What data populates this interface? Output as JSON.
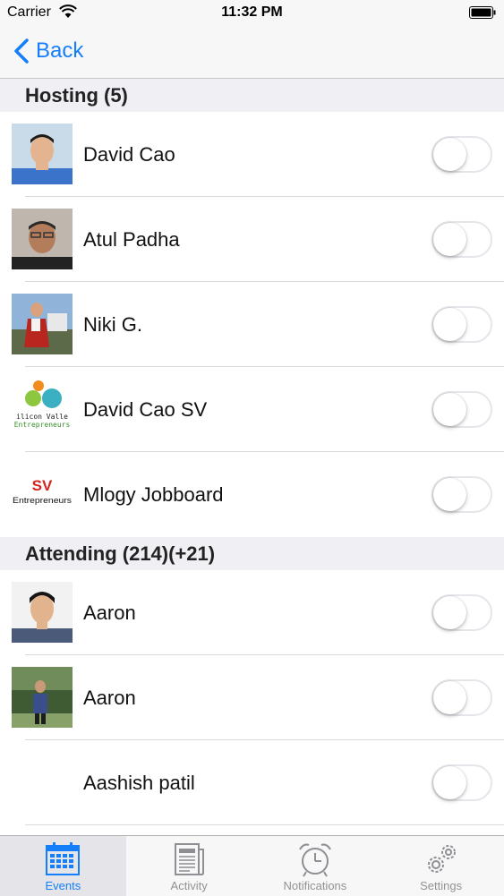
{
  "status_bar": {
    "carrier": "Carrier",
    "time": "11:32 PM"
  },
  "nav": {
    "back_label": "Back"
  },
  "sections": [
    {
      "header": "Hosting (5)",
      "rows": [
        {
          "name": "David Cao",
          "avatar": "photo-man-blue-shirt",
          "toggle_on": false
        },
        {
          "name": "Atul Padha",
          "avatar": "photo-man-glasses",
          "toggle_on": false
        },
        {
          "name": "Niki G.",
          "avatar": "photo-woman-outdoors",
          "toggle_on": false
        },
        {
          "name": "David Cao SV",
          "avatar": "silicon-valley-entrepreneurs-logo",
          "avatar_text": "Silicon Valley Entrepreneurs",
          "toggle_on": false
        },
        {
          "name": "Mlogy Jobboard",
          "avatar": "sv-entrepreneurs-logo",
          "avatar_text": "SV Entrepreneurs",
          "toggle_on": false
        }
      ]
    },
    {
      "header": "Attending (214)(+21)",
      "rows": [
        {
          "name": "Aaron",
          "avatar": "photo-man-suit",
          "toggle_on": false
        },
        {
          "name": "Aaron",
          "avatar": "photo-man-park",
          "toggle_on": false
        },
        {
          "name": "Aashish patil",
          "avatar": "none",
          "toggle_on": false
        }
      ]
    }
  ],
  "tabs": [
    {
      "label": "Events",
      "icon": "calendar-icon",
      "active": true
    },
    {
      "label": "Activity",
      "icon": "newspaper-icon",
      "active": false
    },
    {
      "label": "Notifications",
      "icon": "alarm-clock-icon",
      "active": false
    },
    {
      "label": "Settings",
      "icon": "gears-icon",
      "active": false
    }
  ],
  "colors": {
    "accent": "#157efb",
    "section_bg": "#efeff4",
    "bar_bg": "#f7f7f7"
  }
}
